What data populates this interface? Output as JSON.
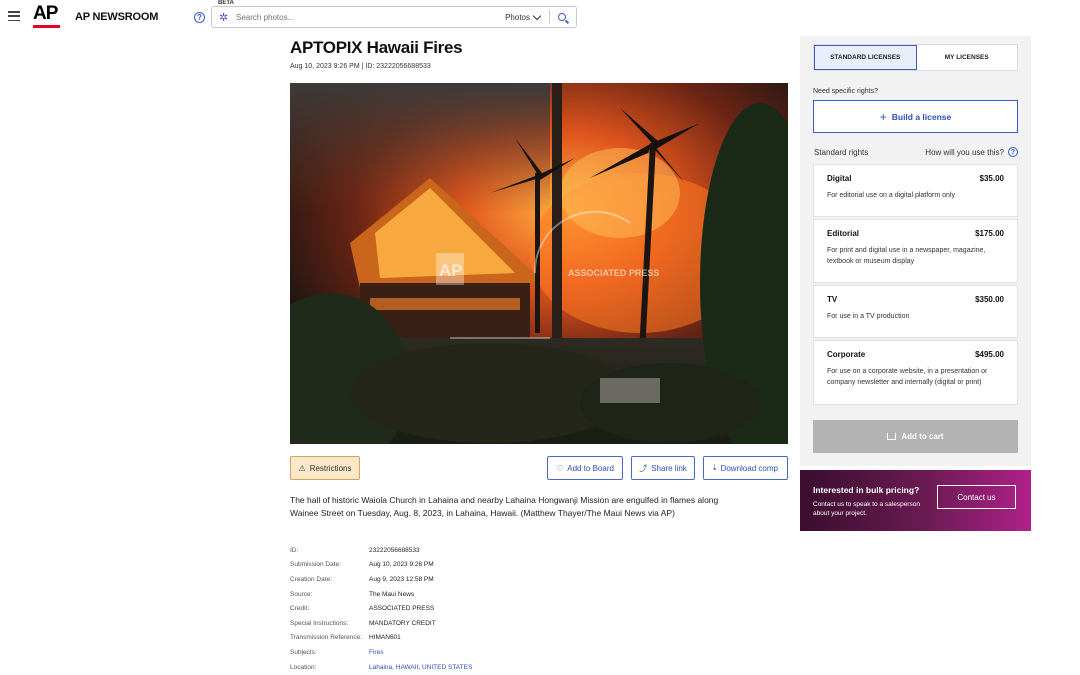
{
  "header": {
    "logo": "AP",
    "brand": "AP NEWSROOM",
    "help": "?",
    "beta": "BETA",
    "search_placeholder": "Search photos...",
    "search_type": "Photos",
    "search_icon": "magnifier-icon",
    "accent_color": "#3b5bcc",
    "logo_color": "#e4002b"
  },
  "photo": {
    "title": "APTOPIX Hawaii Fires",
    "meta": "Aug 10, 2023 9:26 PM  |  ID: 23222056688533",
    "watermark_logo": "AP",
    "watermark_text": "ASSOCIATED PRESS"
  },
  "actions": {
    "restrictions": "Restrictions",
    "add_to_board": "Add to Board",
    "share_link": "Share link",
    "download_comp": "Download comp"
  },
  "caption": "The hall of historic Waiola Church in Lahaina and nearby Lahaina Hongwanji Mission are engulfed in flames along Wainee Street on Tuesday, Aug. 8, 2023, in Lahaina, Hawaii. (Matthew Thayer/The Maui News via AP)",
  "details": [
    {
      "label": "ID:",
      "value": "23222056688533"
    },
    {
      "label": "Submission Date:",
      "value": "Aug 10, 2023 9:26 PM"
    },
    {
      "label": "Creation Date:",
      "value": "Aug 9, 2023 12:58 PM"
    },
    {
      "label": "Source:",
      "value": "The Maui News"
    },
    {
      "label": "Credit:",
      "value": "ASSOCIATED PRESS"
    },
    {
      "label": "Special Instructions:",
      "value": "MANDATORY CREDIT"
    },
    {
      "label": "Transmission Reference:",
      "value": "HIMAN601"
    },
    {
      "label": "Subjects:",
      "value": "Fires"
    },
    {
      "label": "Location:",
      "value": "Lahaina, HAWAII, UNITED STATES"
    }
  ],
  "sidebar": {
    "tab_standard": "STANDARD LICENSES",
    "tab_my": "MY LICENSES",
    "need_rights": "Need specific rights?",
    "build_license": "Build a license",
    "standard_rights": "Standard rights",
    "how_use": "How will you use this?",
    "licenses": [
      {
        "name": "Digital",
        "price": "$35.00",
        "desc": "For editorial use on a digital platform only"
      },
      {
        "name": "Editorial",
        "price": "$175.00",
        "desc": "For print and digital use in a newspaper, magazine, textbook or museum display"
      },
      {
        "name": "TV",
        "price": "$350.00",
        "desc": "For use in a TV production"
      },
      {
        "name": "Corporate",
        "price": "$495.00",
        "desc": "For use on a corporate website, in a presentation or company newsletter and internally (digital or print)"
      }
    ],
    "add_to_cart": "Add to cart"
  },
  "bulk": {
    "title": "Interested in bulk pricing?",
    "subtitle": "Contact us to speak to a salesperson about your project.",
    "contact": "Contact us"
  }
}
